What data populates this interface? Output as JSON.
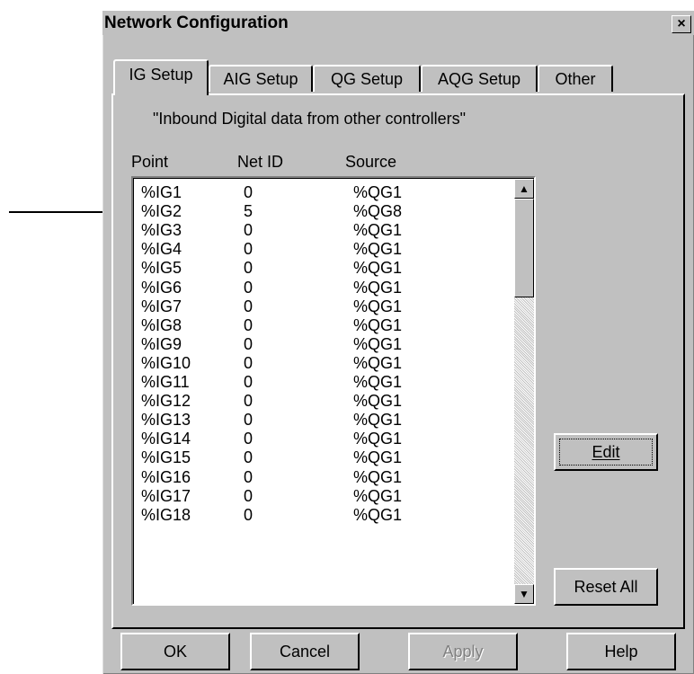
{
  "window": {
    "title": "Network Configuration",
    "close_label": "×"
  },
  "tabs": [
    {
      "label": "IG Setup",
      "active": true
    },
    {
      "label": "AIG Setup",
      "active": false
    },
    {
      "label": "QG Setup",
      "active": false
    },
    {
      "label": "AQG Setup",
      "active": false
    },
    {
      "label": "Other",
      "active": false
    }
  ],
  "panel": {
    "description": "\"Inbound Digital data from other controllers\"",
    "columns": {
      "point": "Point",
      "net_id": "Net ID",
      "source": "Source"
    },
    "rows": [
      {
        "point": "%IG1",
        "net_id": "0",
        "source": "%QG1"
      },
      {
        "point": "%IG2",
        "net_id": "5",
        "source": "%QG8"
      },
      {
        "point": "%IG3",
        "net_id": "0",
        "source": "%QG1"
      },
      {
        "point": "%IG4",
        "net_id": "0",
        "source": "%QG1"
      },
      {
        "point": "%IG5",
        "net_id": "0",
        "source": "%QG1"
      },
      {
        "point": "%IG6",
        "net_id": "0",
        "source": "%QG1"
      },
      {
        "point": "%IG7",
        "net_id": "0",
        "source": "%QG1"
      },
      {
        "point": "%IG8",
        "net_id": "0",
        "source": "%QG1"
      },
      {
        "point": "%IG9",
        "net_id": "0",
        "source": "%QG1"
      },
      {
        "point": "%IG10",
        "net_id": "0",
        "source": "%QG1"
      },
      {
        "point": "%IG11",
        "net_id": "0",
        "source": "%QG1"
      },
      {
        "point": "%IG12",
        "net_id": "0",
        "source": "%QG1"
      },
      {
        "point": "%IG13",
        "net_id": "0",
        "source": "%QG1"
      },
      {
        "point": "%IG14",
        "net_id": "0",
        "source": "%QG1"
      },
      {
        "point": "%IG15",
        "net_id": "0",
        "source": "%QG1"
      },
      {
        "point": "%IG16",
        "net_id": "0",
        "source": "%QG1"
      },
      {
        "point": "%IG17",
        "net_id": "0",
        "source": "%QG1"
      },
      {
        "point": "%IG18",
        "net_id": "0",
        "source": "%QG1"
      }
    ],
    "edit_label": "Edit",
    "reset_all_label": "Reset All"
  },
  "footer": {
    "ok": "OK",
    "cancel": "Cancel",
    "apply": "Apply",
    "help": "Help"
  },
  "colors": {
    "face": "#c0c0c0",
    "highlight": "#ffffff",
    "shadow": "#808080",
    "dark": "#000000"
  }
}
